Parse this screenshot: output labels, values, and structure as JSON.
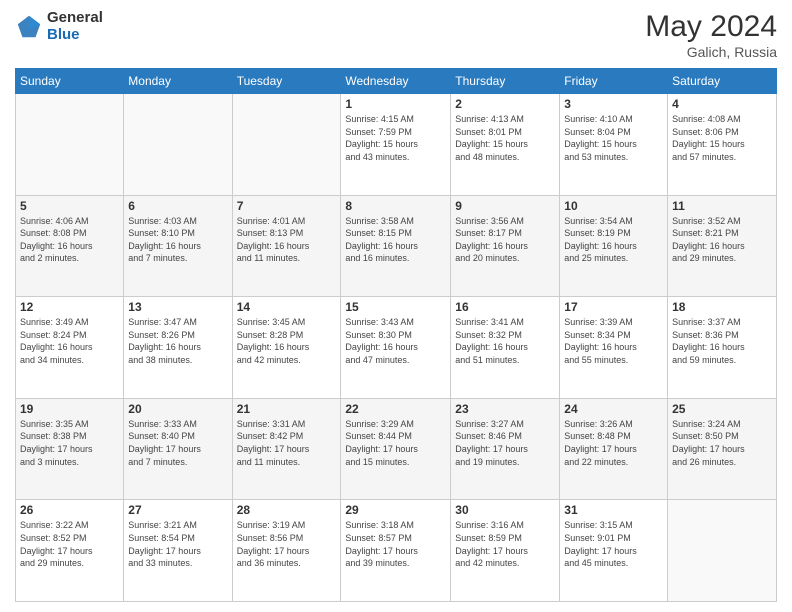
{
  "logo": {
    "general": "General",
    "blue": "Blue"
  },
  "header": {
    "month_year": "May 2024",
    "location": "Galich, Russia"
  },
  "days_of_week": [
    "Sunday",
    "Monday",
    "Tuesday",
    "Wednesday",
    "Thursday",
    "Friday",
    "Saturday"
  ],
  "weeks": [
    [
      {
        "day": "",
        "info": ""
      },
      {
        "day": "",
        "info": ""
      },
      {
        "day": "",
        "info": ""
      },
      {
        "day": "1",
        "info": "Sunrise: 4:15 AM\nSunset: 7:59 PM\nDaylight: 15 hours\nand 43 minutes."
      },
      {
        "day": "2",
        "info": "Sunrise: 4:13 AM\nSunset: 8:01 PM\nDaylight: 15 hours\nand 48 minutes."
      },
      {
        "day": "3",
        "info": "Sunrise: 4:10 AM\nSunset: 8:04 PM\nDaylight: 15 hours\nand 53 minutes."
      },
      {
        "day": "4",
        "info": "Sunrise: 4:08 AM\nSunset: 8:06 PM\nDaylight: 15 hours\nand 57 minutes."
      }
    ],
    [
      {
        "day": "5",
        "info": "Sunrise: 4:06 AM\nSunset: 8:08 PM\nDaylight: 16 hours\nand 2 minutes."
      },
      {
        "day": "6",
        "info": "Sunrise: 4:03 AM\nSunset: 8:10 PM\nDaylight: 16 hours\nand 7 minutes."
      },
      {
        "day": "7",
        "info": "Sunrise: 4:01 AM\nSunset: 8:13 PM\nDaylight: 16 hours\nand 11 minutes."
      },
      {
        "day": "8",
        "info": "Sunrise: 3:58 AM\nSunset: 8:15 PM\nDaylight: 16 hours\nand 16 minutes."
      },
      {
        "day": "9",
        "info": "Sunrise: 3:56 AM\nSunset: 8:17 PM\nDaylight: 16 hours\nand 20 minutes."
      },
      {
        "day": "10",
        "info": "Sunrise: 3:54 AM\nSunset: 8:19 PM\nDaylight: 16 hours\nand 25 minutes."
      },
      {
        "day": "11",
        "info": "Sunrise: 3:52 AM\nSunset: 8:21 PM\nDaylight: 16 hours\nand 29 minutes."
      }
    ],
    [
      {
        "day": "12",
        "info": "Sunrise: 3:49 AM\nSunset: 8:24 PM\nDaylight: 16 hours\nand 34 minutes."
      },
      {
        "day": "13",
        "info": "Sunrise: 3:47 AM\nSunset: 8:26 PM\nDaylight: 16 hours\nand 38 minutes."
      },
      {
        "day": "14",
        "info": "Sunrise: 3:45 AM\nSunset: 8:28 PM\nDaylight: 16 hours\nand 42 minutes."
      },
      {
        "day": "15",
        "info": "Sunrise: 3:43 AM\nSunset: 8:30 PM\nDaylight: 16 hours\nand 47 minutes."
      },
      {
        "day": "16",
        "info": "Sunrise: 3:41 AM\nSunset: 8:32 PM\nDaylight: 16 hours\nand 51 minutes."
      },
      {
        "day": "17",
        "info": "Sunrise: 3:39 AM\nSunset: 8:34 PM\nDaylight: 16 hours\nand 55 minutes."
      },
      {
        "day": "18",
        "info": "Sunrise: 3:37 AM\nSunset: 8:36 PM\nDaylight: 16 hours\nand 59 minutes."
      }
    ],
    [
      {
        "day": "19",
        "info": "Sunrise: 3:35 AM\nSunset: 8:38 PM\nDaylight: 17 hours\nand 3 minutes."
      },
      {
        "day": "20",
        "info": "Sunrise: 3:33 AM\nSunset: 8:40 PM\nDaylight: 17 hours\nand 7 minutes."
      },
      {
        "day": "21",
        "info": "Sunrise: 3:31 AM\nSunset: 8:42 PM\nDaylight: 17 hours\nand 11 minutes."
      },
      {
        "day": "22",
        "info": "Sunrise: 3:29 AM\nSunset: 8:44 PM\nDaylight: 17 hours\nand 15 minutes."
      },
      {
        "day": "23",
        "info": "Sunrise: 3:27 AM\nSunset: 8:46 PM\nDaylight: 17 hours\nand 19 minutes."
      },
      {
        "day": "24",
        "info": "Sunrise: 3:26 AM\nSunset: 8:48 PM\nDaylight: 17 hours\nand 22 minutes."
      },
      {
        "day": "25",
        "info": "Sunrise: 3:24 AM\nSunset: 8:50 PM\nDaylight: 17 hours\nand 26 minutes."
      }
    ],
    [
      {
        "day": "26",
        "info": "Sunrise: 3:22 AM\nSunset: 8:52 PM\nDaylight: 17 hours\nand 29 minutes."
      },
      {
        "day": "27",
        "info": "Sunrise: 3:21 AM\nSunset: 8:54 PM\nDaylight: 17 hours\nand 33 minutes."
      },
      {
        "day": "28",
        "info": "Sunrise: 3:19 AM\nSunset: 8:56 PM\nDaylight: 17 hours\nand 36 minutes."
      },
      {
        "day": "29",
        "info": "Sunrise: 3:18 AM\nSunset: 8:57 PM\nDaylight: 17 hours\nand 39 minutes."
      },
      {
        "day": "30",
        "info": "Sunrise: 3:16 AM\nSunset: 8:59 PM\nDaylight: 17 hours\nand 42 minutes."
      },
      {
        "day": "31",
        "info": "Sunrise: 3:15 AM\nSunset: 9:01 PM\nDaylight: 17 hours\nand 45 minutes."
      },
      {
        "day": "",
        "info": ""
      }
    ]
  ]
}
